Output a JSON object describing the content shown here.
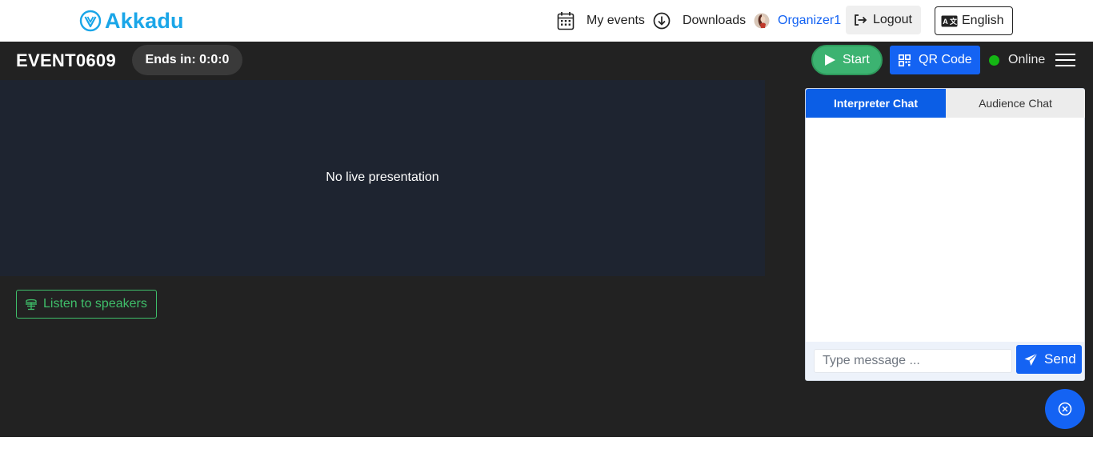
{
  "header": {
    "logo_text": "Akkadu",
    "nav": {
      "my_events": "My events",
      "downloads": "Downloads",
      "user": "Organizer1",
      "logout": "Logout",
      "language": "English"
    }
  },
  "event": {
    "title": "EVENT0609",
    "ends_in": "Ends in: 0:0:0",
    "start_label": "Start",
    "qr_label": "QR Code",
    "status": "Online"
  },
  "presentation": {
    "message": "No live presentation",
    "listen_label": "Listen to speakers"
  },
  "chat": {
    "tabs": [
      "Interpreter Chat",
      "Audience Chat"
    ],
    "input_placeholder": "Type message ...",
    "send_label": "Send"
  },
  "colors": {
    "brand": "#1aa6e8",
    "primary": "#1463f3",
    "start": "#3cb371",
    "online": "#14b614",
    "dark_bg": "#222222"
  }
}
